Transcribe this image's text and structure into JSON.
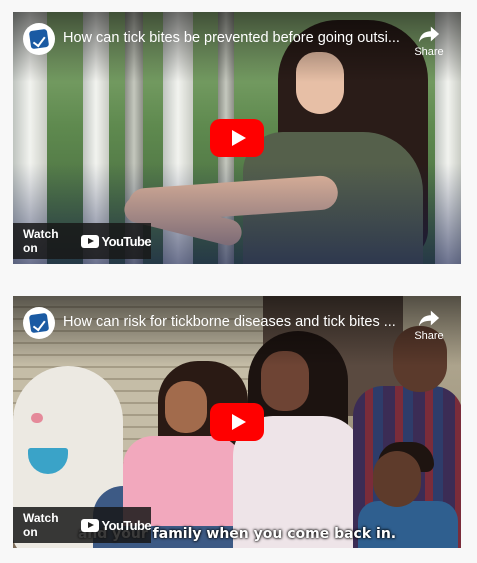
{
  "videos": [
    {
      "title": "How can tick bites be prevented before going outsi...",
      "share_label": "Share",
      "watch_on_label": "Watch on",
      "brand_label": "YouTube",
      "caption": ""
    },
    {
      "title": "How can risk for tickborne diseases and tick bites ...",
      "share_label": "Share",
      "watch_on_label": "Watch on",
      "brand_label": "YouTube",
      "caption": "and your family when you come back in."
    }
  ],
  "colors": {
    "play_button": "#ff0000",
    "channel_badge": "#1a5aa3"
  },
  "icons": {
    "share": "share-arrow-icon",
    "play": "play-icon",
    "channel": "cdc-channel-logo-icon",
    "youtube": "youtube-logo-icon"
  }
}
